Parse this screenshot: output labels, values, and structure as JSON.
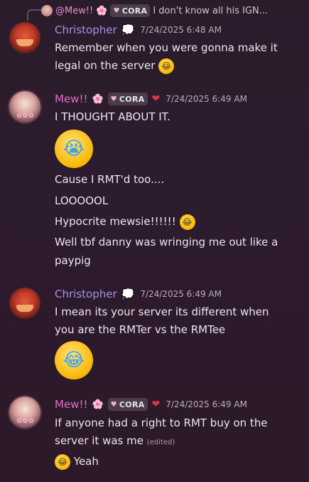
{
  "reply": {
    "name": "@Mew!!",
    "flower": "🌸",
    "tag": "CORA",
    "text": "I don't know all his IGN..."
  },
  "messages": [
    {
      "author": "Christopher",
      "deco": "💭",
      "timestamp": "7/24/2025 6:48 AM",
      "lines": [
        "Remember when you were gonna make it",
        "legal on the server"
      ],
      "trailing_emoji": "rofl-emoji"
    },
    {
      "author": "Mew!!",
      "flower": "🌸",
      "tag": "CORA",
      "deco": "❤",
      "timestamp": "7/24/2025 6:49 AM",
      "lines": [
        "I THOUGHT ABOUT IT.",
        "Cause I RMT'd too....",
        "LOOOOOL",
        "Hypocrite mewsie!!!!!!",
        "Well tbf danny was wringing me out like a",
        "paypig"
      ],
      "big_emoji": "loudly-crying-emoji"
    },
    {
      "author": "Christopher",
      "deco": "💭",
      "timestamp": "7/24/2025 6:49 AM",
      "lines": [
        "I mean its your server its different when",
        "you are the RMTer vs the RMTee"
      ],
      "big_emoji": "joy-emoji"
    },
    {
      "author": "Mew!!",
      "flower": "🌸",
      "tag": "CORA",
      "deco": "❤",
      "timestamp": "7/24/2025 6:49 AM",
      "lines": [
        "If anyone had a right to RMT buy on the",
        "server it was me",
        "Yeah"
      ],
      "edited": "(edited)"
    }
  ]
}
